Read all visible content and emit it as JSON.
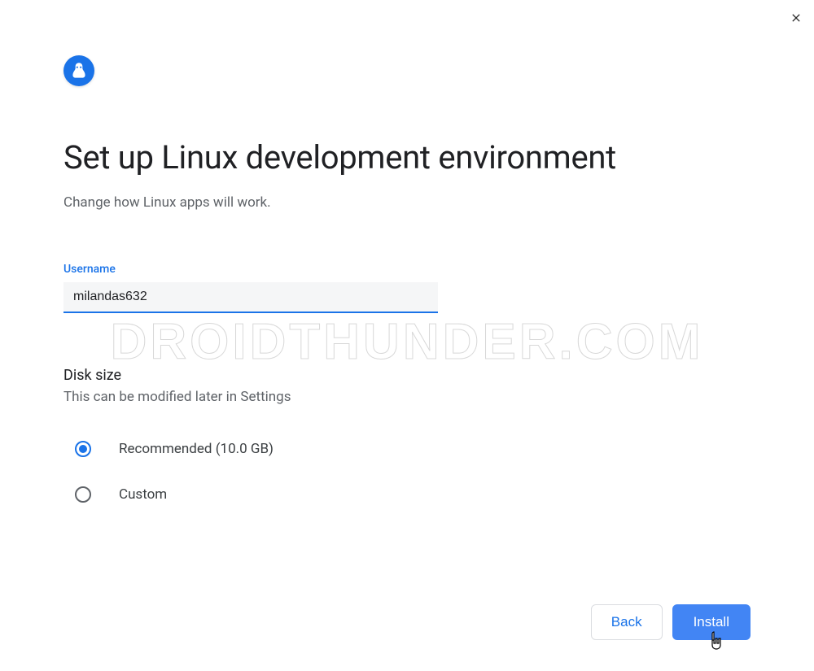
{
  "title": "Set up Linux development environment",
  "subtitle": "Change how Linux apps will work.",
  "username": {
    "label": "Username",
    "value": "milandas632"
  },
  "disk": {
    "title": "Disk size",
    "description": "This can be modified later in Settings",
    "options": [
      {
        "label": "Recommended (10.0 GB)",
        "selected": true
      },
      {
        "label": "Custom",
        "selected": false
      }
    ]
  },
  "buttons": {
    "back": "Back",
    "install": "Install"
  },
  "watermark": "DROIDTHUNDER.COM"
}
